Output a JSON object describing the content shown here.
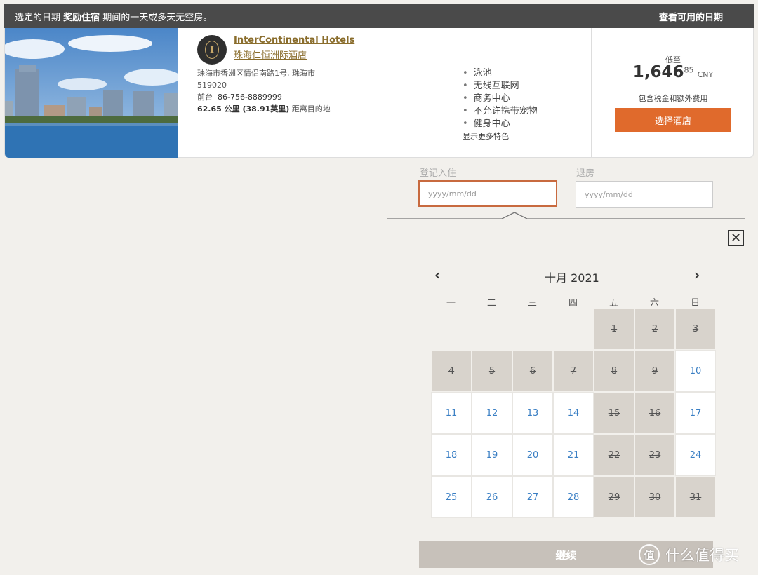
{
  "banner": {
    "prefix": "选定的日期 ",
    "bold": "奖励住宿",
    "suffix": " 期间的一天或多天无空房。",
    "right": "查看可用的日期"
  },
  "hotel": {
    "brand": "InterContinental Hotels",
    "name": "珠海仁恒洲际酒店",
    "address_line1": "珠海市香洲区情侣南路1号, 珠海市",
    "address_line2": "519020",
    "phone_label": "前台",
    "phone": "86-756-8889999",
    "distance_bold": "62.65 公里 (38.91英里)",
    "distance_suffix": " 距离目的地",
    "amenities": [
      "泳池",
      "无线互联网",
      "商务中心",
      "不允许携带宠物",
      "健身中心"
    ],
    "more_features": "显示更多特色",
    "logo_letter": "I"
  },
  "price": {
    "from_label": "低至",
    "amount": "1,646",
    "decimals": "85",
    "currency": "CNY",
    "tax_note": "包含税金和额外费用",
    "select_button": "选择酒店",
    "accent": "#e06a2c"
  },
  "search": {
    "checkin_label": "登记入住",
    "checkout_label": "退房",
    "checkin_placeholder": "yyyy/mm/dd",
    "checkout_placeholder": "yyyy/mm/dd"
  },
  "calendar": {
    "month_title": "十月  2021",
    "prev_icon": "chevron-left-icon",
    "next_icon": "chevron-right-icon",
    "weekdays": [
      "一",
      "二",
      "三",
      "四",
      "五",
      "六",
      "日"
    ],
    "leading_empty": 4,
    "days": [
      {
        "d": "1",
        "available": false
      },
      {
        "d": "2",
        "available": false
      },
      {
        "d": "3",
        "available": false
      },
      {
        "d": "4",
        "available": false
      },
      {
        "d": "5",
        "available": false
      },
      {
        "d": "6",
        "available": false
      },
      {
        "d": "7",
        "available": false
      },
      {
        "d": "8",
        "available": false
      },
      {
        "d": "9",
        "available": false
      },
      {
        "d": "10",
        "available": true
      },
      {
        "d": "11",
        "available": true
      },
      {
        "d": "12",
        "available": true
      },
      {
        "d": "13",
        "available": true
      },
      {
        "d": "14",
        "available": true
      },
      {
        "d": "15",
        "available": false
      },
      {
        "d": "16",
        "available": false
      },
      {
        "d": "17",
        "available": true
      },
      {
        "d": "18",
        "available": true
      },
      {
        "d": "19",
        "available": true
      },
      {
        "d": "20",
        "available": true
      },
      {
        "d": "21",
        "available": true
      },
      {
        "d": "22",
        "available": false
      },
      {
        "d": "23",
        "available": false
      },
      {
        "d": "24",
        "available": true
      },
      {
        "d": "25",
        "available": true
      },
      {
        "d": "26",
        "available": true
      },
      {
        "d": "27",
        "available": true
      },
      {
        "d": "28",
        "available": true
      },
      {
        "d": "29",
        "available": false
      },
      {
        "d": "30",
        "available": false
      },
      {
        "d": "31",
        "available": false
      }
    ]
  },
  "continue_button": "继续",
  "watermark": {
    "circle": "值",
    "text": "什么值得买"
  }
}
